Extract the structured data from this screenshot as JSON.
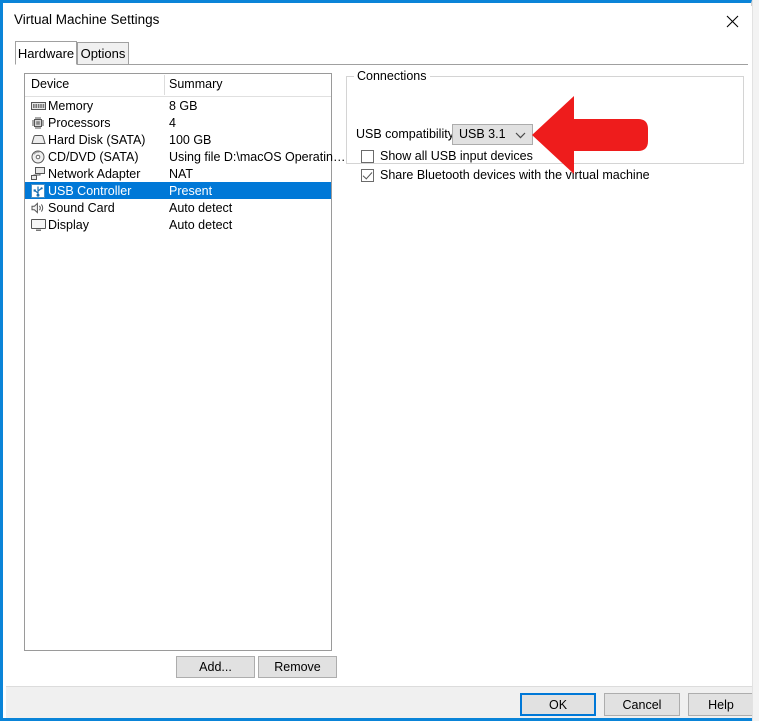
{
  "window": {
    "title": "Virtual Machine Settings",
    "close_icon": "close-icon"
  },
  "tabs": [
    {
      "label": "Hardware",
      "active": true
    },
    {
      "label": "Options",
      "active": false
    }
  ],
  "device_list": {
    "columns": [
      "Device",
      "Summary"
    ],
    "rows": [
      {
        "icon": "memory-icon",
        "name": "Memory",
        "summary": "8 GB",
        "selected": false
      },
      {
        "icon": "processor-icon",
        "name": "Processors",
        "summary": "4",
        "selected": false
      },
      {
        "icon": "hard-disk-icon",
        "name": "Hard Disk (SATA)",
        "summary": "100 GB",
        "selected": false
      },
      {
        "icon": "cd-dvd-icon",
        "name": "CD/DVD (SATA)",
        "summary": "Using file D:\\macOS Operatin…",
        "selected": false
      },
      {
        "icon": "network-adapter-icon",
        "name": "Network Adapter",
        "summary": "NAT",
        "selected": false
      },
      {
        "icon": "usb-controller-icon",
        "name": "USB Controller",
        "summary": "Present",
        "selected": true
      },
      {
        "icon": "sound-card-icon",
        "name": "Sound Card",
        "summary": "Auto detect",
        "selected": false
      },
      {
        "icon": "display-icon",
        "name": "Display",
        "summary": "Auto detect",
        "selected": false
      }
    ]
  },
  "list_actions": {
    "add_label": "Add...",
    "remove_label": "Remove"
  },
  "connections": {
    "group_title": "Connections",
    "usb_compatibility_label": "USB compatibility:",
    "usb_compatibility_value": "USB 3.1",
    "checkboxes": [
      {
        "label": "Show all USB input devices",
        "checked": false
      },
      {
        "label": "Share Bluetooth devices with the virtual machine",
        "checked": true
      }
    ]
  },
  "annotation": {
    "shape": "left-pointing-arrow",
    "color": "#ee1c1c"
  },
  "footer": {
    "ok_label": "OK",
    "cancel_label": "Cancel",
    "help_label": "Help"
  },
  "colors": {
    "accent": "#0a84d8",
    "selection": "#0078d7",
    "arrow_red": "#ee1c1c"
  }
}
